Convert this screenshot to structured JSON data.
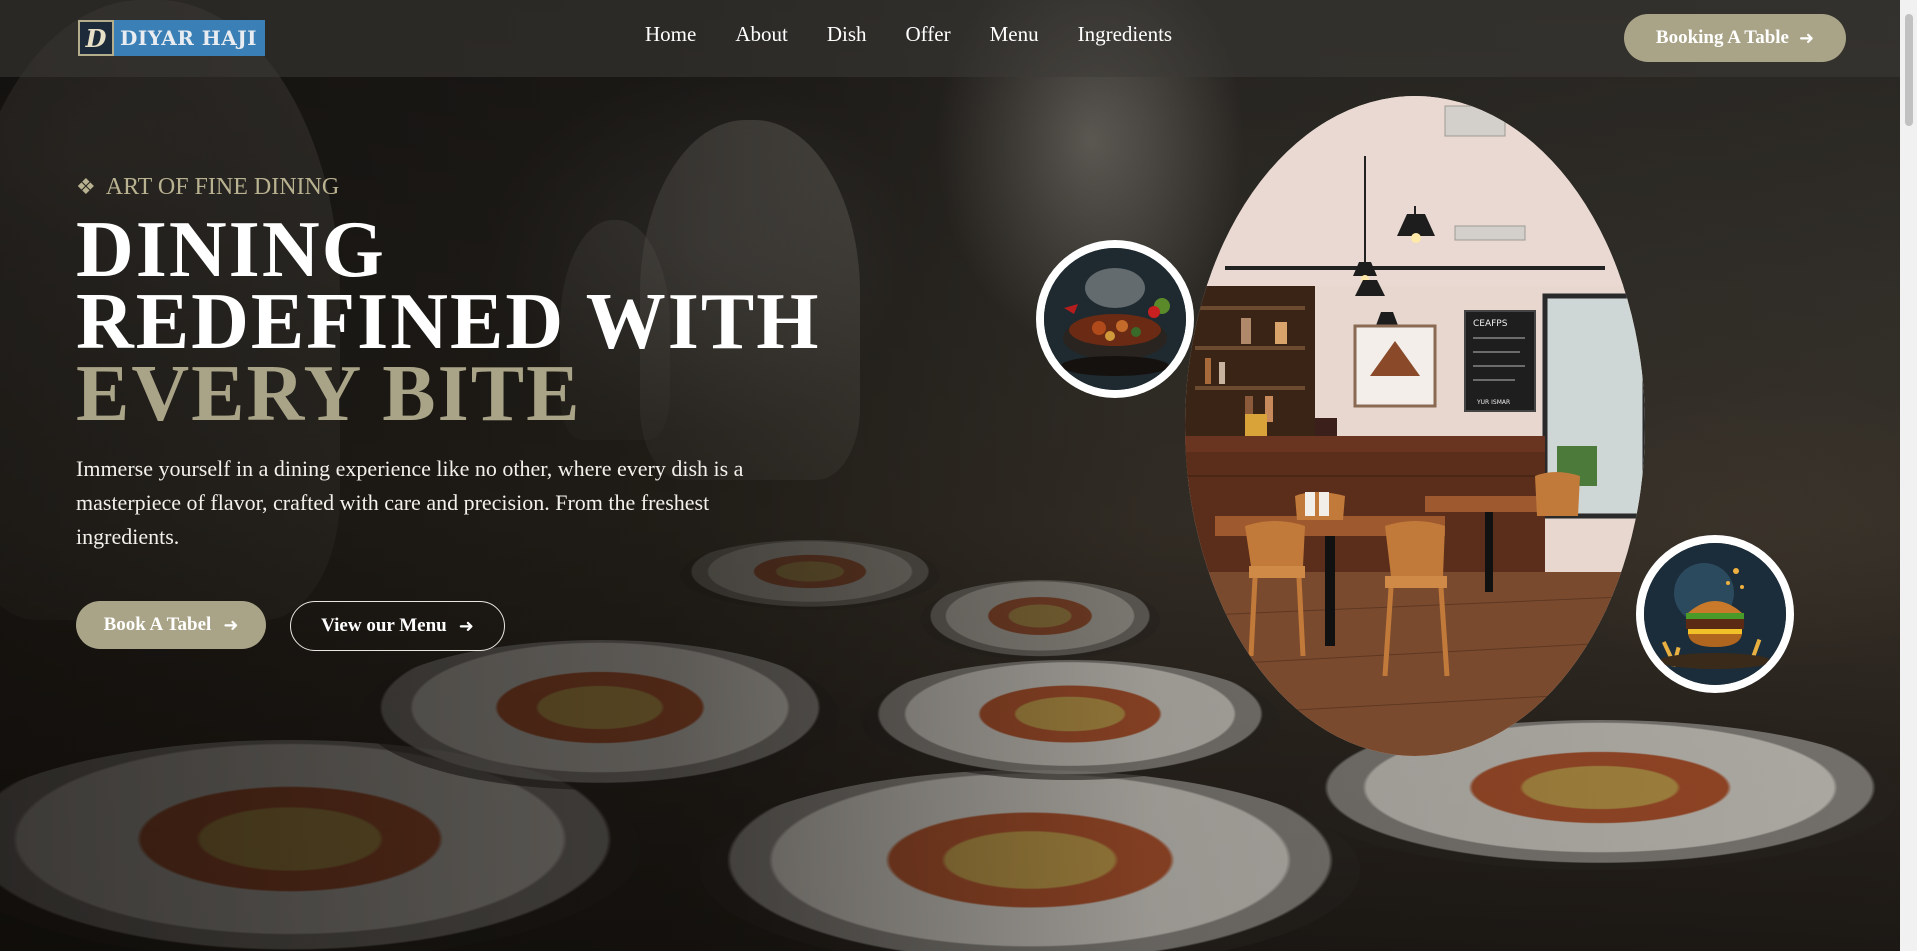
{
  "header": {
    "logo_mark": "D",
    "logo_text": "DIYAR HAJI",
    "nav": [
      "Home",
      "About",
      "Dish",
      "Offer",
      "Menu",
      "Ingredients"
    ],
    "booking_label": "Booking A Table"
  },
  "hero": {
    "eyebrow": "ART OF FINE DINING",
    "title_line1": "DINING",
    "title_line2": "REDEFINED WITH",
    "title_accent": "EVERY BITE",
    "description": "Immerse yourself in a dining experience like no other, where every dish is a masterpiece of flavor, crafted with care and precision. From the freshest ingredients.",
    "book_label": "Book A Tabel",
    "menu_label": "View our Menu"
  },
  "restaurant_sign": {
    "board_title": "CEAFPS",
    "board_footer": "YUR ISMAR"
  },
  "colors": {
    "accent": "#a9a487",
    "eyebrow": "#b9b291",
    "header_bg": "#3c3a37"
  },
  "icons": {
    "eyebrow": "diamond-ornament-icon",
    "button_arrow": "arrow-right-icon"
  }
}
